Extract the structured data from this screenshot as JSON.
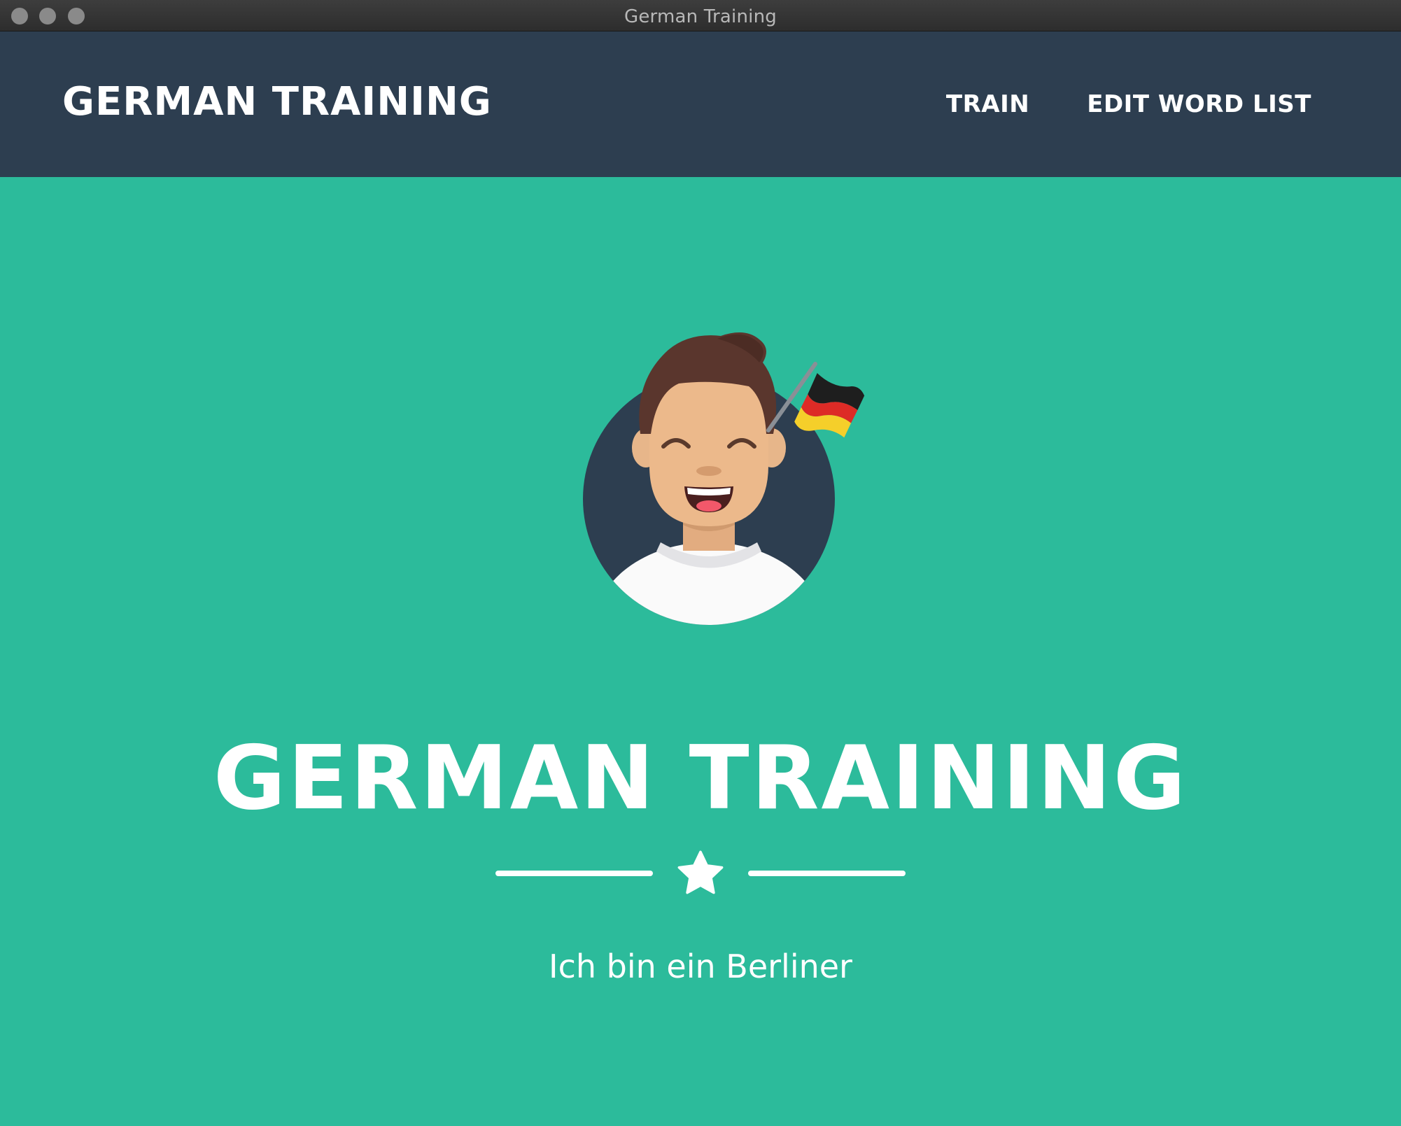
{
  "window": {
    "title": "German Training"
  },
  "nav": {
    "brand": "GERMAN TRAINING",
    "links": [
      {
        "label": "TRAIN"
      },
      {
        "label": "EDIT WORD LIST"
      }
    ]
  },
  "hero": {
    "title": "GERMAN TRAINING",
    "subtitle": "Ich bin ein Berliner",
    "divider_icon": "star-icon",
    "avatar_icon": "person-with-german-flag-icon"
  },
  "colors": {
    "navbar": "#2d3e50",
    "hero_background": "#2cbb9b",
    "text": "#ffffff"
  }
}
